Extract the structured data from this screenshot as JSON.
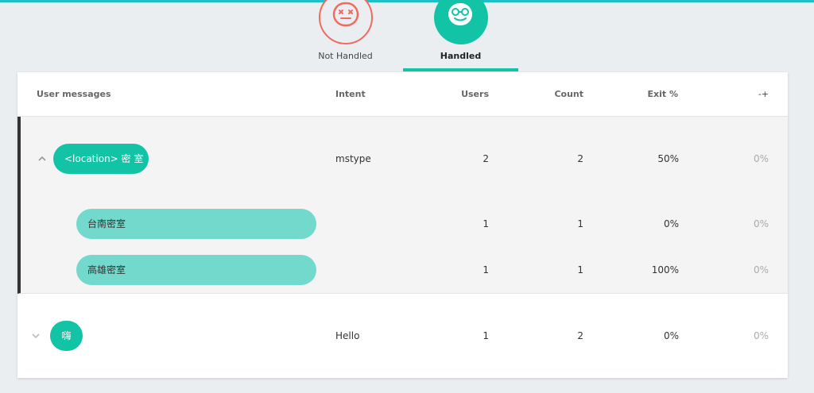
{
  "tabs": {
    "not_handled": {
      "label": "Not Handled"
    },
    "handled": {
      "label": "Handled"
    }
  },
  "table": {
    "headers": {
      "message": "User messages",
      "intent": "Intent",
      "users": "Users",
      "count": "Count",
      "exit": "Exit %",
      "last": "-+"
    },
    "groups": [
      {
        "message": "<location> 密 室",
        "intent": "mstype",
        "users": "2",
        "count": "2",
        "exit": "50%",
        "last": "0%",
        "children": [
          {
            "message": "台南密室",
            "users": "1",
            "count": "1",
            "exit": "0%",
            "last": "0%"
          },
          {
            "message": "高雄密室",
            "users": "1",
            "count": "1",
            "exit": "100%",
            "last": "0%"
          }
        ]
      },
      {
        "message": "嗨",
        "intent": "Hello",
        "users": "1",
        "count": "2",
        "exit": "0%",
        "last": "0%"
      }
    ]
  },
  "colors": {
    "accent": "#12c3a6",
    "accent_light": "#73d9cc",
    "not_handled": "#f06a5d",
    "top_bar": "#1ec0c6"
  }
}
